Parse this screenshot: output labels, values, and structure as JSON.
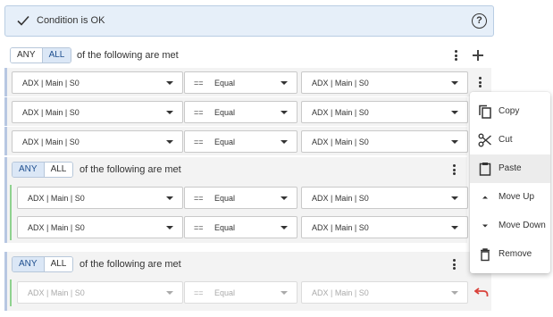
{
  "status": {
    "text": "Condition is OK",
    "help_icon": "help-circle-icon",
    "check_icon": "check-icon"
  },
  "groups": [
    {
      "any_label": "ANY",
      "all_label": "ALL",
      "active": "ALL",
      "phrase": "of the following are met"
    },
    {
      "any_label": "ANY",
      "all_label": "ALL",
      "active": "ANY",
      "phrase": "of the following are met"
    },
    {
      "any_label": "ANY",
      "all_label": "ALL",
      "active": "ANY",
      "phrase": "of the following are met"
    }
  ],
  "rows": [
    {
      "left": "ADX | Main | S0",
      "op_symbol": "==",
      "op_label": "Equal",
      "right": "ADX | Main | S0"
    },
    {
      "left": "ADX | Main | S0",
      "op_symbol": "==",
      "op_label": "Equal",
      "right": "ADX | Main | S0"
    },
    {
      "left": "ADX | Main | S0",
      "op_symbol": "==",
      "op_label": "Equal",
      "right": "ADX | Main | S0"
    },
    {
      "left": "ADX | Main | S0",
      "op_symbol": "==",
      "op_label": "Equal",
      "right": "ADX | Main | S0"
    },
    {
      "left": "ADX | Main | S0",
      "op_symbol": "==",
      "op_label": "Equal",
      "right": "ADX | Main | S0"
    },
    {
      "left": "ADX | Main | S0",
      "op_symbol": "==",
      "op_label": "Equal",
      "right": "ADX | Main | S0"
    }
  ],
  "menu": {
    "items": [
      {
        "label": "Copy",
        "icon": "copy-icon"
      },
      {
        "label": "Cut",
        "icon": "scissors-icon"
      },
      {
        "label": "Paste",
        "icon": "clipboard-icon",
        "highlighted": true
      },
      {
        "label": "Move Up",
        "icon": "arrow-up-icon"
      },
      {
        "label": "Move Down",
        "icon": "arrow-down-icon"
      },
      {
        "label": "Remove",
        "icon": "trash-icon"
      }
    ]
  },
  "colors": {
    "accent": "#1f4f8f",
    "status_bg": "#e6eff9",
    "group_bar": "#b7c7e2",
    "nested_bar": "#8fd28f",
    "undo": "#d9413a"
  }
}
